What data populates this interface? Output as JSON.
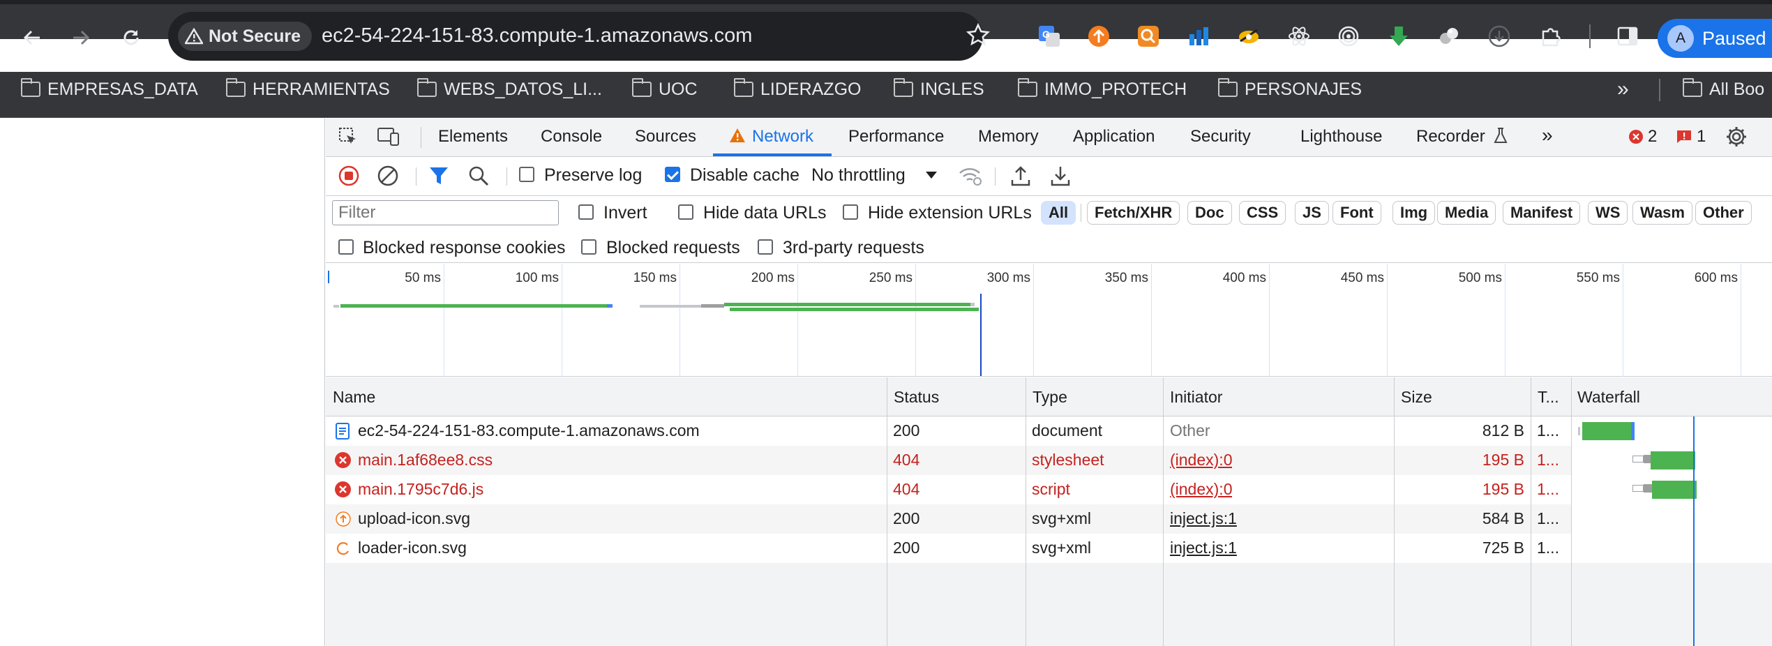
{
  "browser": {
    "security_label": "Not Secure",
    "url": "ec2-54-224-151-83.compute-1.amazonaws.com",
    "profile_initial": "A",
    "profile_status": "Paused"
  },
  "bookmarks": [
    "EMPRESAS_DATA",
    "HERRAMIENTAS",
    "WEBS_DATOS_LI...",
    "UOC",
    "LIDERAZGO",
    "INGLES",
    "IMMO_PROTECH",
    "PERSONAJES"
  ],
  "bookmarks_more": "All Boo",
  "devtools": {
    "tabs": [
      "Elements",
      "Console",
      "Sources",
      "Network",
      "Performance",
      "Memory",
      "Application",
      "Security",
      "Lighthouse",
      "Recorder"
    ],
    "active_tab": "Network",
    "error_count": "2",
    "issue_count": "1"
  },
  "network": {
    "preserve_log": "Preserve log",
    "disable_cache": "Disable cache",
    "throttling": "No throttling",
    "filter_placeholder": "Filter",
    "invert": "Invert",
    "hide_data_urls": "Hide data URLs",
    "hide_extension_urls": "Hide extension URLs",
    "type_filters": [
      "All",
      "Fetch/XHR",
      "Doc",
      "CSS",
      "JS",
      "Font",
      "Img",
      "Media",
      "Manifest",
      "WS",
      "Wasm",
      "Other"
    ],
    "active_type": "All",
    "blocked_cookies": "Blocked response cookies",
    "blocked_requests": "Blocked requests",
    "third_party": "3rd-party requests",
    "timeline_ticks": [
      "50 ms",
      "100 ms",
      "150 ms",
      "200 ms",
      "250 ms",
      "300 ms",
      "350 ms",
      "400 ms",
      "450 ms",
      "500 ms",
      "550 ms",
      "600 ms"
    ],
    "columns": [
      "Name",
      "Status",
      "Type",
      "Initiator",
      "Size",
      "T...",
      "Waterfall"
    ],
    "rows": [
      {
        "name": "ec2-54-224-151-83.compute-1.amazonaws.com",
        "status": "200",
        "type": "document",
        "initiator": "Other",
        "size": "812 B",
        "time": "1...",
        "error": false,
        "icon": "document-icon"
      },
      {
        "name": "main.1af68ee8.css",
        "status": "404",
        "type": "stylesheet",
        "initiator": "(index):0",
        "size": "195 B",
        "time": "1...",
        "error": true,
        "icon": "error-icon"
      },
      {
        "name": "main.1795c7d6.js",
        "status": "404",
        "type": "script",
        "initiator": "(index):0",
        "size": "195 B",
        "time": "1...",
        "error": true,
        "icon": "error-icon"
      },
      {
        "name": "upload-icon.svg",
        "status": "200",
        "type": "svg+xml",
        "initiator": "inject.js:1",
        "size": "584 B",
        "time": "1...",
        "error": false,
        "icon": "upload-icon"
      },
      {
        "name": "loader-icon.svg",
        "status": "200",
        "type": "svg+xml",
        "initiator": "inject.js:1",
        "size": "725 B",
        "time": "1...",
        "error": false,
        "icon": "loader-icon"
      }
    ]
  }
}
